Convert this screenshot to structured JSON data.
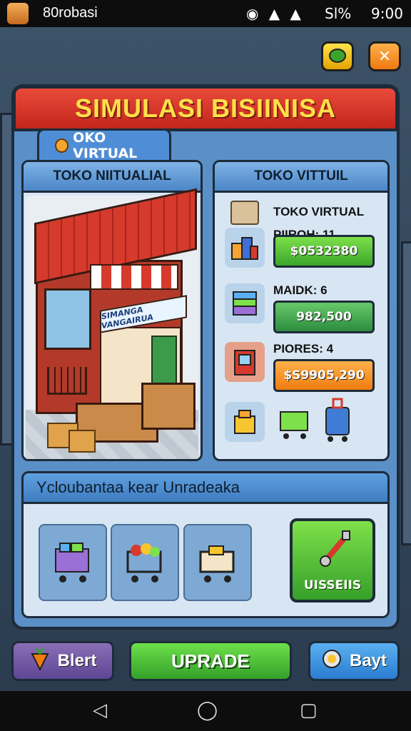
{
  "status_bar": {
    "app_title": "80robasi",
    "battery": "Sl%",
    "time": "9:00"
  },
  "top_buttons": {
    "chat_icon": "chat-bubble-icon",
    "close_icon": "close-icon"
  },
  "title": "SIMULASI BISIINISA",
  "tab_label": "OKO VIRTUAL",
  "left_panel": {
    "header": "TOKO NIITUALIAL",
    "shop_sign": "SIMANGA VANGAIRUA"
  },
  "right_panel": {
    "header": "TOKO VITTUIL",
    "shop_label": "TOKO VIRTUAL",
    "rows": [
      {
        "label": "PIIROH: 11",
        "value": "$0532380",
        "icon": "goods-icon"
      },
      {
        "label": "MAIDK: 6",
        "value": "982,500",
        "icon": "stack-icon"
      },
      {
        "label": "PIORES: 4",
        "value": "$S9905,290",
        "icon": "machine-icon"
      }
    ]
  },
  "upgrade_section": {
    "header": "Ycloubantaa kear Unradeaka",
    "use_button": "UISSEIIS"
  },
  "bottom_bar": {
    "back_label": "Blert",
    "upgrade_label": "UPRADE",
    "buy_label": "Bayt"
  },
  "colors": {
    "title_red": "#d6362a",
    "title_text": "#ffe04a",
    "panel_blue": "#5b8fc7",
    "green_button": "#3aa52a",
    "orange_button": "#ef7d10"
  }
}
